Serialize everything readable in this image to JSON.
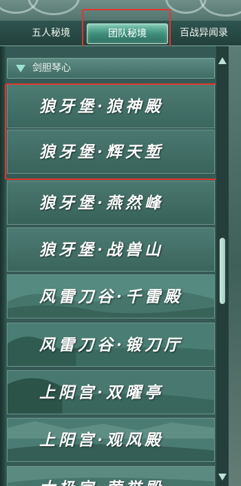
{
  "tabs": [
    {
      "label": "五人秘境",
      "active": false
    },
    {
      "label": "团队秘境",
      "active": true
    },
    {
      "label": "百战异闻录",
      "active": false
    }
  ],
  "category": {
    "label": "剑胆琴心",
    "expanded": true
  },
  "dungeons": [
    {
      "name": "狼牙堡·狼神殿"
    },
    {
      "name": "狼牙堡·辉天堑"
    },
    {
      "name": "狼牙堡·燕然峰"
    },
    {
      "name": "狼牙堡·战兽山"
    },
    {
      "name": "风雷刀谷·千雷殿"
    },
    {
      "name": "风雷刀谷·锻刀厅"
    },
    {
      "name": "上阳宫·双曜亭"
    },
    {
      "name": "上阳宫·观风殿"
    },
    {
      "name": "太极宫·荣誉殿"
    }
  ],
  "colors": {
    "highlight": "#e2352b",
    "active_tab": "#3f8f7c",
    "list_bg": "#355a55"
  },
  "icons": {
    "expand": "triangle-down-icon",
    "scroll_up": "triangle-up-icon",
    "scroll_down": "triangle-down-icon"
  }
}
